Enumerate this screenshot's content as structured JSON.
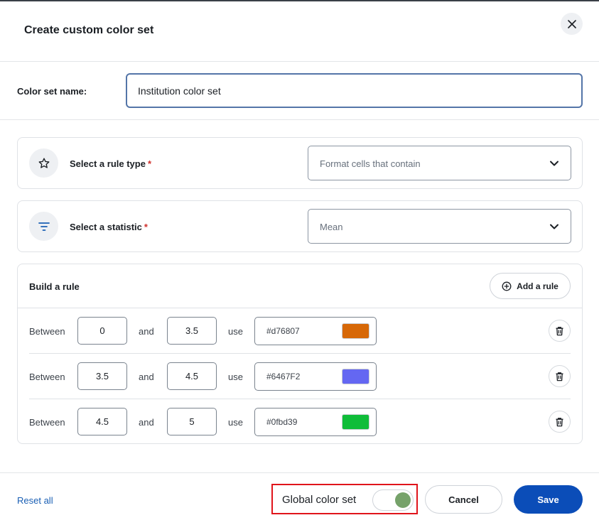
{
  "dialog": {
    "title": "Create custom color set"
  },
  "name_field": {
    "label": "Color set name:",
    "value": "Institution color set"
  },
  "rule_type": {
    "label": "Select a rule type",
    "required_mark": "*",
    "selected": "Format cells that contain",
    "icon": "star-icon"
  },
  "statistic": {
    "label": "Select a statistic",
    "required_mark": "*",
    "selected": "Mean",
    "icon": "filter-icon"
  },
  "build": {
    "title": "Build a rule",
    "add_label": "Add a rule",
    "between_label": "Between",
    "and_label": "and",
    "use_label": "use",
    "rules": [
      {
        "from": "0",
        "to": "3.5",
        "hex": "#d76807",
        "color": "#d76807"
      },
      {
        "from": "3.5",
        "to": "4.5",
        "hex": "#6467F2",
        "color": "#6467F2"
      },
      {
        "from": "4.5",
        "to": "5",
        "hex": "#0fbd39",
        "color": "#0fbd39"
      }
    ]
  },
  "footer": {
    "reset_label": "Reset all",
    "global_label": "Global color set",
    "global_enabled": true,
    "cancel_label": "Cancel",
    "save_label": "Save"
  },
  "colors": {
    "primary": "#0b4db8",
    "toggle_on": "#76a26a",
    "highlight": "#e0141b"
  }
}
